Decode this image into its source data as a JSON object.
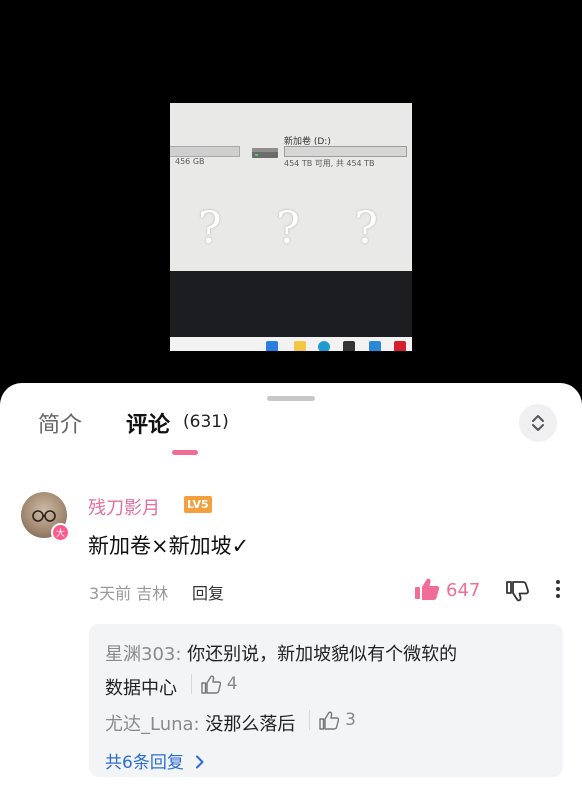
{
  "video": {
    "drive_left_size": "456 GB",
    "drive_name": "新加卷 (D:)",
    "drive_free": "454 TB 可用, 共 454 TB",
    "question_marks": [
      "?",
      "?",
      "?"
    ]
  },
  "tabs": {
    "intro": "简介",
    "comments": "评论",
    "comments_count": "(631)"
  },
  "comment": {
    "username": "残刀影月",
    "level": "LV5",
    "avatar_badge": "大",
    "text": "新加卷×新加坡✓",
    "meta": "3天前 吉林",
    "reply_label": "回复",
    "like_count": "647"
  },
  "replies": {
    "items": [
      {
        "name": "星渊303:",
        "text": " 你还别说，新加坡貌似有个微软的",
        "text_cont": "数据中心",
        "likes": "4"
      },
      {
        "name": "尤达_Luna:",
        "text": " 没那么落后",
        "likes": "3"
      }
    ],
    "total_label": "共6条回复"
  },
  "colors": {
    "accent_pink": "#f26d96",
    "link_blue": "#2b6dd6",
    "level_orange": "#f5a03f"
  }
}
